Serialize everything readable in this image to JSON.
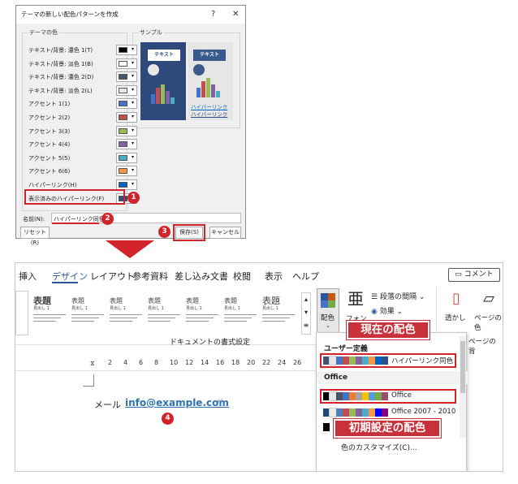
{
  "dialog": {
    "title": "テーマの新しい配色パターンを作成",
    "help": "?",
    "close": "✕",
    "theme_colors_label": "テーマの色",
    "sample_label": "サンプル",
    "rows": [
      {
        "label": "テキスト/背景: 濃色 1(T)",
        "color": "#000000"
      },
      {
        "label": "テキスト/背景: 淡色 1(B)",
        "color": "#ffffff"
      },
      {
        "label": "テキスト/背景: 濃色 2(D)",
        "color": "#44546a"
      },
      {
        "label": "テキスト/背景: 淡色 2(L)",
        "color": "#e7e6e6"
      },
      {
        "label": "アクセント 1(1)",
        "color": "#4472c4"
      },
      {
        "label": "アクセント 2(2)",
        "color": "#c0504d"
      },
      {
        "label": "アクセント 3(3)",
        "color": "#9bbb59"
      },
      {
        "label": "アクセント 4(4)",
        "color": "#8064a2"
      },
      {
        "label": "アクセント 5(5)",
        "color": "#4bacc6"
      },
      {
        "label": "アクセント 6(6)",
        "color": "#f79646"
      },
      {
        "label": "ハイパーリンク(H)",
        "color": "#0563c1"
      },
      {
        "label": "表示済みのハイパーリンク(F)",
        "color": "#2b4f86"
      }
    ],
    "sample_text": "テキスト",
    "sample_links": [
      "ハイパーリンク",
      "ハイパーリンク"
    ],
    "name_label": "名前(N):",
    "name_value": "ハイパーリンク同色",
    "reset_button": "リセット(R)",
    "save_button": "保存(S)",
    "cancel_button": "キャンセル",
    "badges": [
      "1",
      "2",
      "3",
      "4"
    ]
  },
  "ribbon": {
    "tabs": [
      "挿入",
      "デザイン",
      "レイアウト",
      "参考資料",
      "差し込み文書",
      "校閲",
      "表示",
      "ヘルプ"
    ],
    "comment_button": "コメント",
    "styles": [
      "表題",
      "表題",
      "表題",
      "表題",
      "表題",
      "表題",
      "表題"
    ],
    "style_sub": "見出し 1",
    "colors_button": "配色",
    "fonts_button": "フォント",
    "paragraph_spacing": "段落の間隔",
    "effects": "効果",
    "watermark": "透かし",
    "page_color": "ページの色",
    "page_bg_tail": "ページの背",
    "doc_format_label": "ドキュメントの書式設定"
  },
  "ruler_numbers": [
    "2",
    "4",
    "6",
    "8",
    "10",
    "12",
    "14",
    "16",
    "18",
    "20",
    "22",
    "24",
    "26"
  ],
  "document": {
    "mail_label": "メール",
    "email": "info@example.com"
  },
  "menu": {
    "user_defined_label": "ユーザー定義",
    "custom_scheme": "ハイパーリンク同色",
    "office_label": "Office",
    "office_scheme": "Office",
    "office_2007": "Office 2007 - 2010",
    "customize": "色のカスタマイズ(C)..."
  },
  "callouts": {
    "current": "現在の配色",
    "initial": "初期設定の配色"
  },
  "scheme_colors": {
    "custom": [
      "#44546a",
      "#e7e6e6",
      "#4472c4",
      "#c0504d",
      "#9bbb59",
      "#8064a2",
      "#4bacc6",
      "#f79646",
      "#0563c1",
      "#2b4f86"
    ],
    "office": [
      "#000000",
      "#e7e6e6",
      "#44546a",
      "#4472c4",
      "#ed7d31",
      "#a5a5a5",
      "#ffc000",
      "#5b9bd5",
      "#70ad47",
      "#954f72"
    ],
    "office2007": [
      "#1f497d",
      "#eeece1",
      "#4f81bd",
      "#c0504d",
      "#9bbb59",
      "#8064a2",
      "#4bacc6",
      "#f79646",
      "#0000ff",
      "#800080"
    ]
  }
}
